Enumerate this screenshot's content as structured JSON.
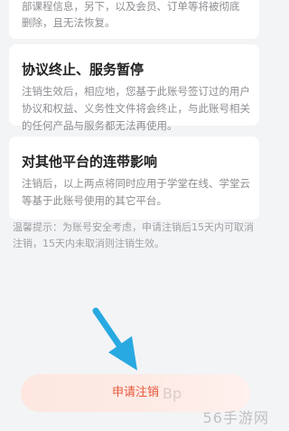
{
  "top_card": {
    "partial_text": "部课程信息，另下，以及会员、订单等将被彻底删除，且无法恢复。"
  },
  "agreement_card": {
    "title": "协议终止、服务暂停",
    "body": "注销生效后，相应地，您基于此账号签订过的用户协议和权益、义务性文件将会终止，与此账号相关的任何产品与服务都无法再使用。"
  },
  "platform_card": {
    "title": "对其他平台的连带影响",
    "body": "注销后，以上两点将同时应用于学堂在线、学堂云等基于此账号使用的其它平台。"
  },
  "tip": {
    "text": "温馨提示：为账号安全考虑，申请注销后15天内可取消注销，15天内未取消则注销生效。"
  },
  "apply_button": {
    "label": "申请注销"
  },
  "watermark": {
    "text": "56手游网",
    "partial": "Bp"
  },
  "colors": {
    "page_bg": "#f3f4f6",
    "card_bg": "#ffffff",
    "button_text": "#e8573a",
    "button_bg": "#fde7e0",
    "arrow": "#29a9e1"
  }
}
